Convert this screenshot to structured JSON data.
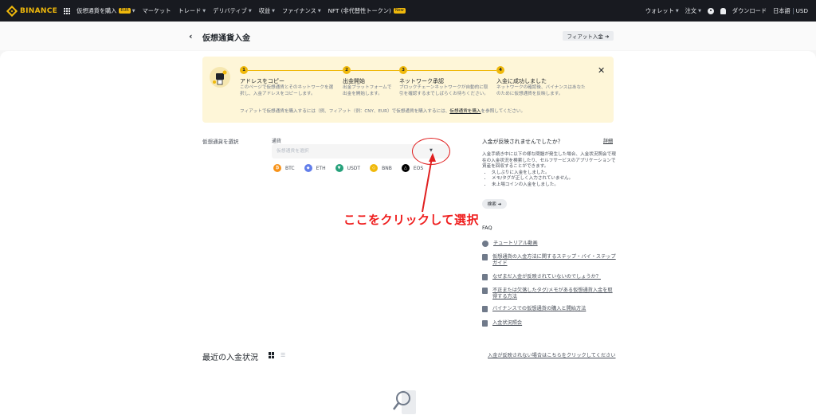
{
  "topnav": {
    "logo": "BINANCE",
    "items": [
      {
        "label": "仮想通貨を購入",
        "badge": "EUR"
      },
      {
        "label": "マーケット"
      },
      {
        "label": "トレード"
      },
      {
        "label": "デリバティブ"
      },
      {
        "label": "収益"
      },
      {
        "label": "ファイナンス"
      },
      {
        "label": "NFT (非代替性トークン)",
        "badge": "New"
      }
    ],
    "right": {
      "wallet": "ウォレット",
      "orders": "注文",
      "download": "ダウンロード",
      "language": "日本語",
      "currency": "USD"
    }
  },
  "header": {
    "title": "仮想通貨入金",
    "fiat_button": "フィアット入金 ➔"
  },
  "steps": [
    {
      "num": "1",
      "title": "アドレスをコピー",
      "desc": "このページで仮想通貨とそのネットワークを選択し、入金アドレスをコピーします。"
    },
    {
      "num": "2",
      "title": "出金開始",
      "desc": "出金プラットフォームで出金を開始します。"
    },
    {
      "num": "3",
      "title": "ネットワーク承認",
      "desc": "ブロックチェーンネットワークが自動的に取引を確認するまでしばらくお待ちください。"
    },
    {
      "num": "4",
      "title": "入金に成功しました",
      "desc": "ネットワークの確認後、バイナンスはあなたのために仮想通貨を反映します。"
    }
  ],
  "banner_foot": {
    "text": "フィアットで仮想通貨を購入するには（例、フィアット（例：CNY、EUR）で仮想通貨を購入するには、",
    "link": "仮想通貨を購入",
    "tail": "を参照してください。"
  },
  "form": {
    "select_label": "仮想通貨を選択",
    "coin_label": "通貨",
    "coin_placeholder": "仮想通貨を選択",
    "quick_coins": [
      {
        "symbol": "BTC",
        "color": "#f7931a"
      },
      {
        "symbol": "ETH",
        "color": "#627eea"
      },
      {
        "symbol": "USDT",
        "color": "#26a17b"
      },
      {
        "symbol": "BNB",
        "color": "#f0b90b"
      },
      {
        "symbol": "EOS",
        "color": "#000000"
      }
    ]
  },
  "annotation": {
    "text": "ここをクリックして選択",
    "color": "#ef1e1e"
  },
  "help": {
    "title": "入金が反映されませんでしたか？",
    "detail": "詳細",
    "intro": "入金手続き中に以下の様な問題が発生した場合、入金状況照会で現在の入金状況を検索したり、セルフサービスのアプリケーションで資産を回収することができます。",
    "bullets": [
      "久しぶりに入金をしました。",
      "メモ/タグが正しく入力されていません。",
      "未上場コインの入金をしました。"
    ],
    "search_button": "検索 ➔"
  },
  "faq": {
    "title": "FAQ",
    "items": [
      {
        "label": "チュートリアル動画",
        "icon": "play-icon"
      },
      {
        "label": "仮想通貨の入金方法に関するステップ・バイ・ステップガイド",
        "icon": "document-icon"
      },
      {
        "label": "なぜまだ入金が反映されていないのでしょうか？",
        "icon": "document-icon"
      },
      {
        "label": "不正または欠落したタグ/メモがある仮想通貨入金を取得する方法",
        "icon": "document-icon"
      },
      {
        "label": "バイナンスでの仮想通貨の購入と開始方法",
        "icon": "document-icon"
      },
      {
        "label": "入金状況照会",
        "icon": "document-icon"
      }
    ]
  },
  "recent": {
    "title": "最近の入金状況",
    "link": "入金が反映されない場合はこちらをクリックしてください"
  }
}
